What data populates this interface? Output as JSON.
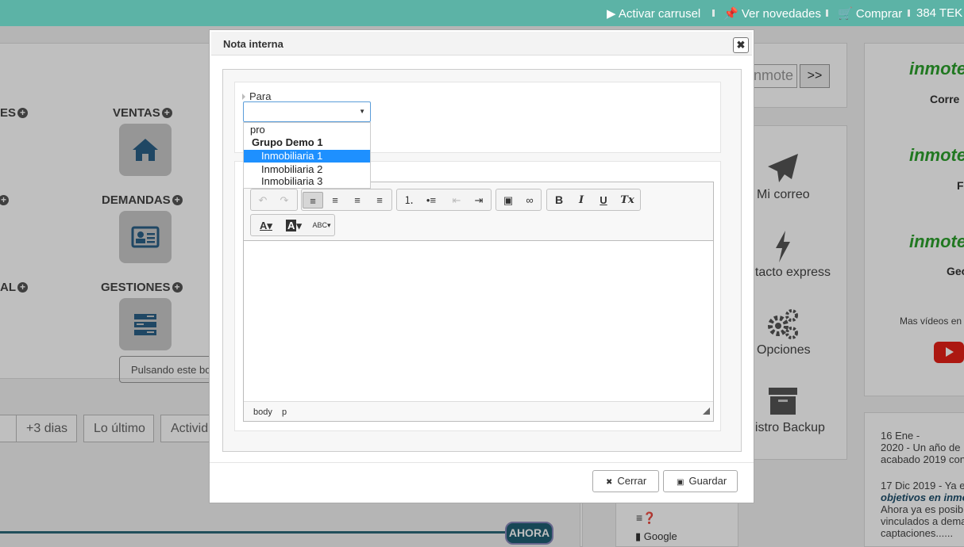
{
  "topbar": {
    "carousel": "Activar carrusel",
    "news": "Ver novedades",
    "buy": "Comprar",
    "credits": "384 TEK"
  },
  "page": {
    "categories": {
      "ventas": "VENTAS",
      "demandas": "DEMANDAS",
      "gestiones": "GESTIONES",
      "partial_es": "ES",
      "partial_al": "AL"
    },
    "hint": "Pulsando este bo",
    "tabs": [
      "+3 dias",
      "Lo último",
      "Activid"
    ],
    "ahora": "AHORA",
    "search_value": "nmote",
    "go_label": ">>",
    "right_items": [
      "Mi correo",
      "ntacto express",
      "Opciones",
      "gistro Backup"
    ],
    "brand": "inmote",
    "brand_subs": [
      "Corre",
      "F",
      "Geo"
    ],
    "videos": "Mas vídeos en",
    "news_items": [
      "16 Ene -",
      "2020 -  Un año de",
      "acabado 2019 con",
      "17 Dic 2019 - Ya e",
      "objetivos en inmo",
      "Ahora ya es posibl",
      "vinculados a dema",
      "captaciones......"
    ],
    "google": "Google"
  },
  "modal": {
    "title": "Nota interna",
    "close_glyph": "✖",
    "para_label": "Para",
    "select_value": "",
    "options": [
      {
        "label": "pro",
        "style": "plain"
      },
      {
        "label": "Grupo Demo 1",
        "style": "group"
      },
      {
        "label": "Inmobiliaria 1",
        "style": "selected"
      },
      {
        "label": "Inmobiliaria 2",
        "style": "child"
      },
      {
        "label": "Inmobiliaria 3",
        "style": "child"
      }
    ],
    "toolbar": {
      "undo": "↶",
      "redo": "↷",
      "align_left": "≡",
      "align_center": "≡",
      "align_right": "≡",
      "justify": "≡",
      "ordered_list": "⒈",
      "bullet_list": "•≡",
      "outdent": "⇤",
      "indent": "⇥",
      "image": "▣",
      "link": "∞",
      "bold": "B",
      "italic": "I",
      "underline": "U",
      "clear_format": "Tx",
      "text_color": "A",
      "bg_color": "A",
      "spellcheck": "ABC"
    },
    "path": [
      "body",
      "p"
    ],
    "footer": {
      "close": "Cerrar",
      "save": "Guardar"
    }
  },
  "colors": {
    "topbar": "#5cb3a6",
    "brand_green": "#2ca02c",
    "selection": "#1e90ff",
    "timeline": "#2c6a7a"
  }
}
